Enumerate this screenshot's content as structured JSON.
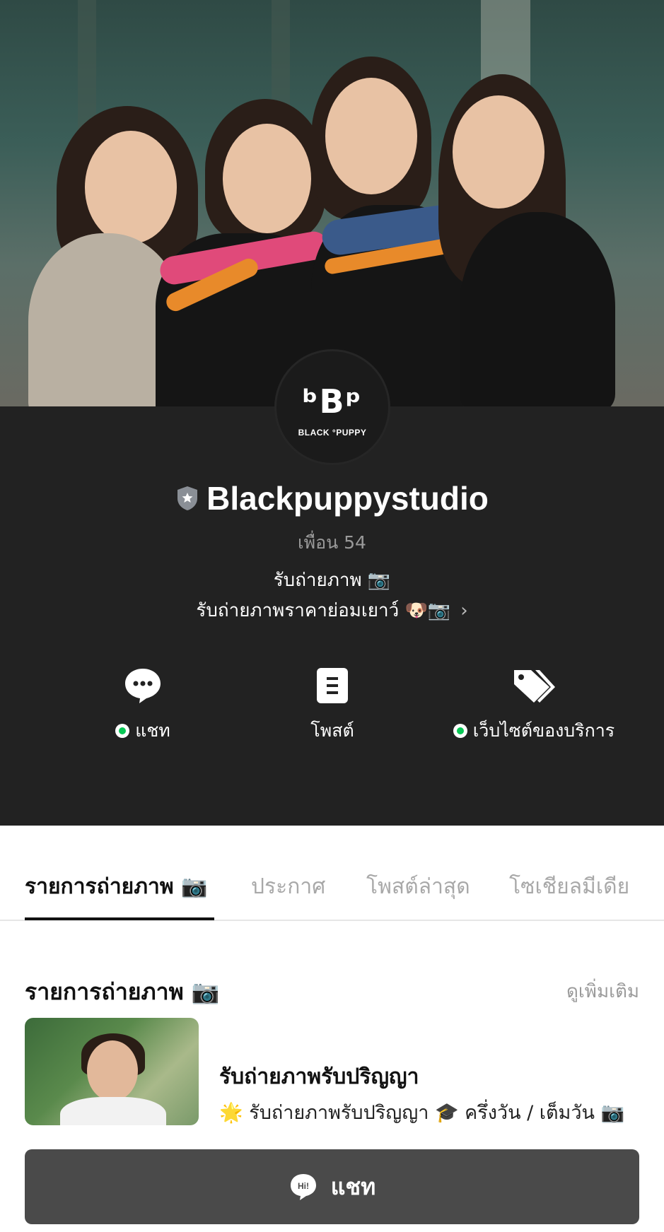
{
  "profile": {
    "name": "Blackpuppystudio",
    "friends": "เพื่อน 54",
    "status_line1": "รับถ่ายภาพ 📷",
    "status_line2": "รับถ่ายภาพราคาย่อมเยาว์ 🐶📷",
    "logo_mark": "ᵇBᵖ",
    "logo_brand": "BLACK °PUPPY"
  },
  "actions": [
    {
      "label": "แชท",
      "icon": "chat-bubble-icon",
      "online": true
    },
    {
      "label": "โพสต์",
      "icon": "post-icon",
      "online": false
    },
    {
      "label": "เว็บไซต์ของบริการ",
      "icon": "tag-icon",
      "online": true
    }
  ],
  "tabs": [
    {
      "label": "รายการถ่ายภาพ 📷",
      "active": true
    },
    {
      "label": "ประกาศ",
      "active": false
    },
    {
      "label": "โพสต์ล่าสุด",
      "active": false
    },
    {
      "label": "โซเชียลมีเดีย",
      "active": false
    }
  ],
  "section": {
    "title": "รายการถ่ายภาพ 📷",
    "see_more": "ดูเพิ่มเติม"
  },
  "card": {
    "title": "รับถ่ายภาพรับปริญญา",
    "description": "🌟 รับถ่ายภาพรับปริญญา 🎓 ครึ่งวัน / เต็มวัน 📷"
  },
  "bottom_bar": {
    "label": "แชท",
    "icon": "hi-bubble-icon"
  },
  "colors": {
    "profile_bg": "#222222",
    "online_green": "#08c755",
    "chat_bar": "#4a4a4a"
  }
}
